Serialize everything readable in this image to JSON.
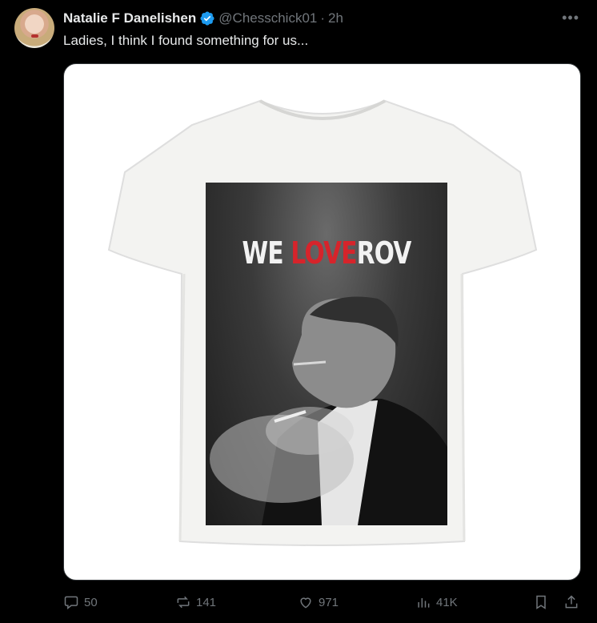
{
  "post": {
    "author_name": "Natalie F Danelishen",
    "handle": "@Chesschick01",
    "separator": "·",
    "time": "2h",
    "more_icon": "more-horizontal-icon",
    "text": "Ladies, I think I found something for us..."
  },
  "media": {
    "poster_title_part1": "WE ",
    "poster_title_part2": "LOVE",
    "poster_title_part3": "ROV"
  },
  "actions": {
    "replies": "50",
    "reposts": "141",
    "likes": "971",
    "views": "41K"
  },
  "colors": {
    "background": "#000000",
    "text_primary": "#e7e9ea",
    "text_secondary": "#71767b",
    "verified_blue": "#1d9bf0",
    "poster_red": "#d6242b"
  }
}
